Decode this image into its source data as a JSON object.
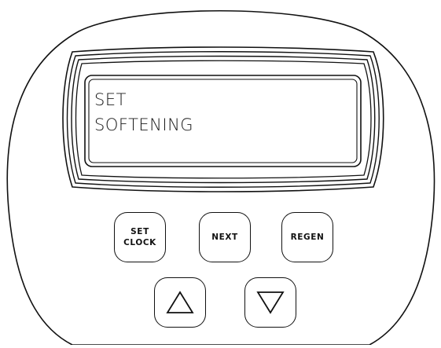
{
  "display": {
    "line1": "SET",
    "line2": "SOFTENING"
  },
  "buttons": {
    "set_clock_line1": "SET",
    "set_clock_line2": "CLOCK",
    "next": "NEXT",
    "regen": "REGEN",
    "up_icon": "triangle-up-icon",
    "down_icon": "triangle-down-icon"
  },
  "colors": {
    "outline": "#111111",
    "background": "#ffffff",
    "text": "#1a1a1a"
  }
}
